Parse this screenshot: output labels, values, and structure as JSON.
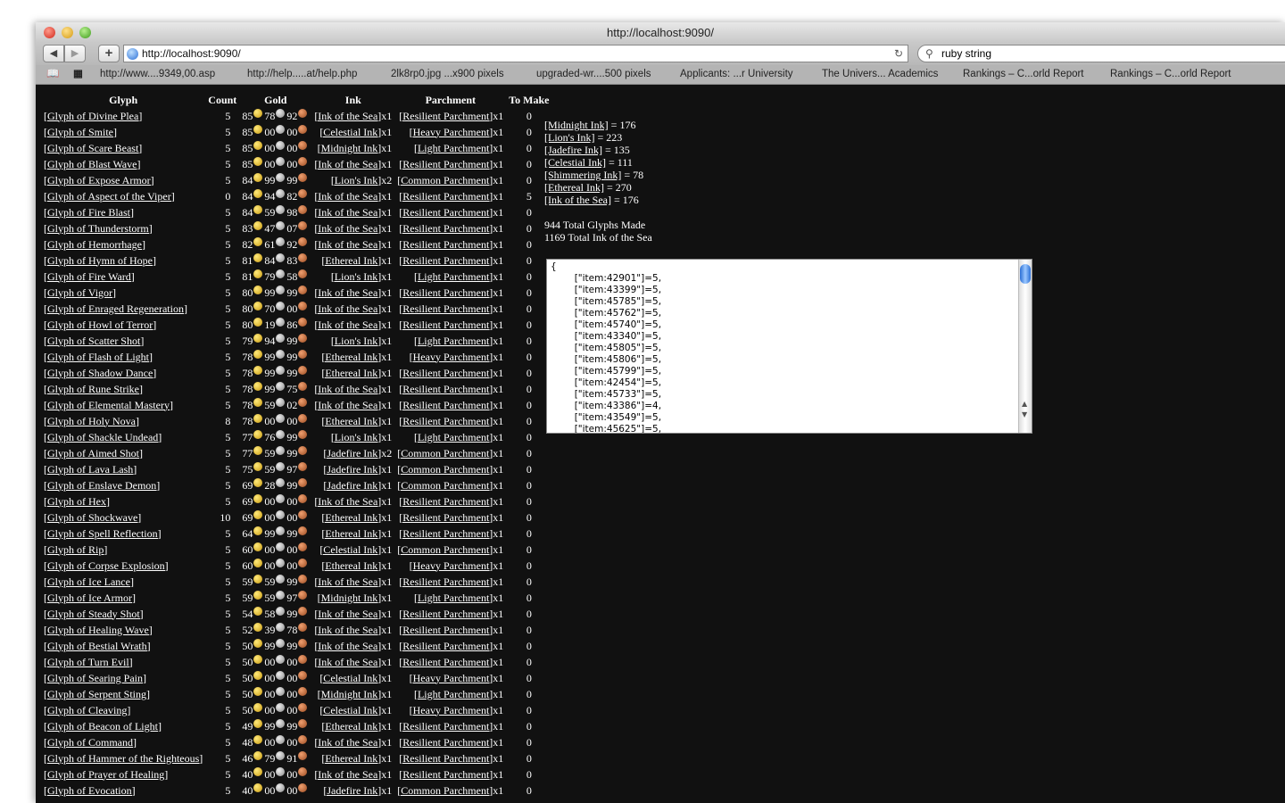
{
  "window": {
    "title": "http://localhost:9090/"
  },
  "toolbar": {
    "url": "http://localhost:9090/",
    "search": "ruby string",
    "add": "+",
    "back": "◀",
    "forward": "▶",
    "reload": "↻"
  },
  "bookmarks": [
    "http://www....9349,00.asp",
    "http://help.....at/help.php",
    "2lk8rp0.jpg ...x900 pixels",
    "upgraded-wr....500 pixels",
    "Applicants: ...r University",
    "The Univers... Academics",
    "Rankings – C...orld Report",
    "Rankings – C...orld Report"
  ],
  "table": {
    "headers": [
      "Glyph",
      "Count",
      "Gold",
      "Ink",
      "Parchment",
      "To Make"
    ],
    "rows": [
      [
        "Glyph of Divine Plea",
        5,
        "85",
        "78",
        "92",
        "Ink of the Sea",
        "x1",
        "Resilient Parchment",
        "x1",
        0
      ],
      [
        "Glyph of Smite",
        5,
        "85",
        "00",
        "00",
        "Celestial Ink",
        "x1",
        "Heavy Parchment",
        "x1",
        0
      ],
      [
        "Glyph of Scare Beast",
        5,
        "85",
        "00",
        "00",
        "Midnight Ink",
        "x1",
        "Light Parchment",
        "x1",
        0
      ],
      [
        "Glyph of Blast Wave",
        5,
        "85",
        "00",
        "00",
        "Ink of the Sea",
        "x1",
        "Resilient Parchment",
        "x1",
        0
      ],
      [
        "Glyph of Expose Armor",
        5,
        "84",
        "99",
        "99",
        "Lion's Ink",
        "x2",
        "Common Parchment",
        "x1",
        0
      ],
      [
        "Glyph of Aspect of the Viper",
        0,
        "84",
        "94",
        "82",
        "Ink of the Sea",
        "x1",
        "Resilient Parchment",
        "x1",
        5
      ],
      [
        "Glyph of Fire Blast",
        5,
        "84",
        "59",
        "98",
        "Ink of the Sea",
        "x1",
        "Resilient Parchment",
        "x1",
        0
      ],
      [
        "Glyph of Thunderstorm",
        5,
        "83",
        "47",
        "07",
        "Ink of the Sea",
        "x1",
        "Resilient Parchment",
        "x1",
        0
      ],
      [
        "Glyph of Hemorrhage",
        5,
        "82",
        "61",
        "92",
        "Ink of the Sea",
        "x1",
        "Resilient Parchment",
        "x1",
        0
      ],
      [
        "Glyph of Hymn of Hope",
        5,
        "81",
        "84",
        "83",
        "Ethereal Ink",
        "x1",
        "Resilient Parchment",
        "x1",
        0
      ],
      [
        "Glyph of Fire Ward",
        5,
        "81",
        "79",
        "58",
        "Lion's Ink",
        "x1",
        "Light Parchment",
        "x1",
        0
      ],
      [
        "Glyph of Vigor",
        5,
        "80",
        "99",
        "99",
        "Ink of the Sea",
        "x1",
        "Resilient Parchment",
        "x1",
        0
      ],
      [
        "Glyph of Enraged Regeneration",
        5,
        "80",
        "70",
        "00",
        "Ink of the Sea",
        "x1",
        "Resilient Parchment",
        "x1",
        0
      ],
      [
        "Glyph of Howl of Terror",
        5,
        "80",
        "19",
        "86",
        "Ink of the Sea",
        "x1",
        "Resilient Parchment",
        "x1",
        0
      ],
      [
        "Glyph of Scatter Shot",
        5,
        "79",
        "94",
        "99",
        "Lion's Ink",
        "x1",
        "Light Parchment",
        "x1",
        0
      ],
      [
        "Glyph of Flash of Light",
        5,
        "78",
        "99",
        "99",
        "Ethereal Ink",
        "x1",
        "Heavy Parchment",
        "x1",
        0
      ],
      [
        "Glyph of Shadow Dance",
        5,
        "78",
        "99",
        "99",
        "Ethereal Ink",
        "x1",
        "Resilient Parchment",
        "x1",
        0
      ],
      [
        "Glyph of Rune Strike",
        5,
        "78",
        "99",
        "75",
        "Ink of the Sea",
        "x1",
        "Resilient Parchment",
        "x1",
        0
      ],
      [
        "Glyph of Elemental Mastery",
        5,
        "78",
        "59",
        "02",
        "Ink of the Sea",
        "x1",
        "Resilient Parchment",
        "x1",
        0
      ],
      [
        "Glyph of Holy Nova",
        8,
        "78",
        "00",
        "00",
        "Ethereal Ink",
        "x1",
        "Resilient Parchment",
        "x1",
        0
      ],
      [
        "Glyph of Shackle Undead",
        5,
        "77",
        "76",
        "99",
        "Lion's Ink",
        "x1",
        "Light Parchment",
        "x1",
        0
      ],
      [
        "Glyph of Aimed Shot",
        5,
        "77",
        "59",
        "99",
        "Jadefire Ink",
        "x2",
        "Common Parchment",
        "x1",
        0
      ],
      [
        "Glyph of Lava Lash",
        5,
        "75",
        "59",
        "97",
        "Jadefire Ink",
        "x1",
        "Common Parchment",
        "x1",
        0
      ],
      [
        "Glyph of Enslave Demon",
        5,
        "69",
        "28",
        "99",
        "Jadefire Ink",
        "x1",
        "Common Parchment",
        "x1",
        0
      ],
      [
        "Glyph of Hex",
        5,
        "69",
        "00",
        "00",
        "Ink of the Sea",
        "x1",
        "Resilient Parchment",
        "x1",
        0
      ],
      [
        "Glyph of Shockwave",
        10,
        "69",
        "00",
        "00",
        "Ethereal Ink",
        "x1",
        "Resilient Parchment",
        "x1",
        0
      ],
      [
        "Glyph of Spell Reflection",
        5,
        "64",
        "99",
        "99",
        "Ethereal Ink",
        "x1",
        "Resilient Parchment",
        "x1",
        0
      ],
      [
        "Glyph of Rip",
        5,
        "60",
        "00",
        "00",
        "Celestial Ink",
        "x1",
        "Common Parchment",
        "x1",
        0
      ],
      [
        "Glyph of Corpse Explosion",
        5,
        "60",
        "00",
        "00",
        "Ethereal Ink",
        "x1",
        "Heavy Parchment",
        "x1",
        0
      ],
      [
        "Glyph of Ice Lance",
        5,
        "59",
        "59",
        "99",
        "Ink of the Sea",
        "x1",
        "Resilient Parchment",
        "x1",
        0
      ],
      [
        "Glyph of Ice Armor",
        5,
        "59",
        "59",
        "97",
        "Midnight Ink",
        "x1",
        "Light Parchment",
        "x1",
        0
      ],
      [
        "Glyph of Steady Shot",
        5,
        "54",
        "58",
        "99",
        "Ink of the Sea",
        "x1",
        "Resilient Parchment",
        "x1",
        0
      ],
      [
        "Glyph of Healing Wave",
        5,
        "52",
        "39",
        "78",
        "Ink of the Sea",
        "x1",
        "Resilient Parchment",
        "x1",
        0
      ],
      [
        "Glyph of Bestial Wrath",
        5,
        "50",
        "99",
        "99",
        "Ink of the Sea",
        "x1",
        "Resilient Parchment",
        "x1",
        0
      ],
      [
        "Glyph of Turn Evil",
        5,
        "50",
        "00",
        "00",
        "Ink of the Sea",
        "x1",
        "Resilient Parchment",
        "x1",
        0
      ],
      [
        "Glyph of Searing Pain",
        5,
        "50",
        "00",
        "00",
        "Celestial Ink",
        "x1",
        "Heavy Parchment",
        "x1",
        0
      ],
      [
        "Glyph of Serpent Sting",
        5,
        "50",
        "00",
        "00",
        "Midnight Ink",
        "x1",
        "Light Parchment",
        "x1",
        0
      ],
      [
        "Glyph of Cleaving",
        5,
        "50",
        "00",
        "00",
        "Celestial Ink",
        "x1",
        "Heavy Parchment",
        "x1",
        0
      ],
      [
        "Glyph of Beacon of Light",
        5,
        "49",
        "99",
        "99",
        "Ethereal Ink",
        "x1",
        "Resilient Parchment",
        "x1",
        0
      ],
      [
        "Glyph of Command",
        5,
        "48",
        "00",
        "00",
        "Ink of the Sea",
        "x1",
        "Resilient Parchment",
        "x1",
        0
      ],
      [
        "Glyph of Hammer of the Righteous",
        5,
        "46",
        "79",
        "91",
        "Ethereal Ink",
        "x1",
        "Resilient Parchment",
        "x1",
        0
      ],
      [
        "Glyph of Prayer of Healing",
        5,
        "40",
        "00",
        "00",
        "Ink of the Sea",
        "x1",
        "Resilient Parchment",
        "x1",
        0
      ],
      [
        "Glyph of Evocation",
        5,
        "40",
        "00",
        "00",
        "Jadefire Ink",
        "x1",
        "Common Parchment",
        "x1",
        0
      ]
    ]
  },
  "ink_totals": [
    [
      "Midnight Ink",
      "176"
    ],
    [
      "Lion's Ink",
      "223"
    ],
    [
      "Jadefire Ink",
      "135"
    ],
    [
      "Celestial Ink",
      "111"
    ],
    [
      "Shimmering Ink",
      "78"
    ],
    [
      "Ethereal Ink",
      "270"
    ],
    [
      "Ink of the Sea",
      "176"
    ]
  ],
  "summary": {
    "glyphs": "944 Total Glyphs Made",
    "ink": "1169 Total Ink of the Sea"
  },
  "textarea": "{\n\t[\"item:42901\"]=5,\n\t[\"item:43399\"]=5,\n\t[\"item:45785\"]=5,\n\t[\"item:45762\"]=5,\n\t[\"item:45740\"]=5,\n\t[\"item:43340\"]=5,\n\t[\"item:45805\"]=5,\n\t[\"item:45806\"]=5,\n\t[\"item:45799\"]=5,\n\t[\"item:42454\"]=5,\n\t[\"item:45733\"]=5,\n\t[\"item:43386\"]=4,\n\t[\"item:43549\"]=5,\n\t[\"item:45625\"]=5,",
  "colors": {
    "background": "#111111",
    "text": "#ffffff"
  }
}
